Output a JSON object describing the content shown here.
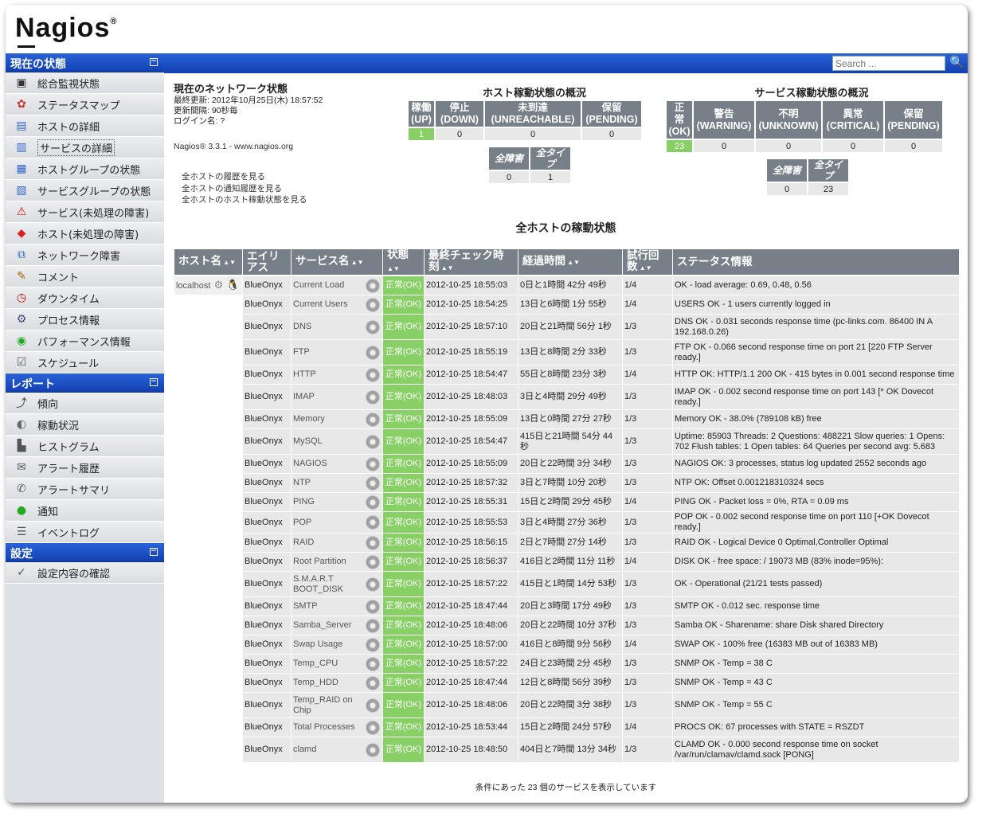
{
  "brand": {
    "logo": "Nagios",
    "mark": "®"
  },
  "sidebar": {
    "sections": [
      {
        "title": "現在の状態",
        "items": [
          {
            "label": "総合監視状態",
            "icon": "monitor-icon"
          },
          {
            "label": "ステータスマップ",
            "icon": "map-icon"
          },
          {
            "label": "ホストの詳細",
            "icon": "host-icon"
          },
          {
            "label": "サービスの詳細",
            "icon": "service-icon",
            "selected": true
          },
          {
            "label": "ホストグループの状態",
            "icon": "hostgroup-icon"
          },
          {
            "label": "サービスグループの状態",
            "icon": "servicegroup-icon"
          },
          {
            "label": "サービス(未処理の障害)",
            "icon": "service-problem-icon"
          },
          {
            "label": "ホスト(未処理の障害)",
            "icon": "host-problem-icon"
          },
          {
            "label": "ネットワーク障害",
            "icon": "network-outage-icon"
          },
          {
            "label": "コメント",
            "icon": "comment-icon"
          },
          {
            "label": "ダウンタイム",
            "icon": "downtime-icon"
          },
          {
            "label": "プロセス情報",
            "icon": "process-icon"
          },
          {
            "label": "パフォーマンス情報",
            "icon": "performance-icon"
          },
          {
            "label": "スケジュール",
            "icon": "schedule-icon"
          }
        ]
      },
      {
        "title": "レポート",
        "items": [
          {
            "label": "傾向",
            "icon": "trend-icon"
          },
          {
            "label": "稼動状況",
            "icon": "availability-icon"
          },
          {
            "label": "ヒストグラム",
            "icon": "histogram-icon"
          },
          {
            "label": "アラート履歴",
            "icon": "alert-history-icon"
          },
          {
            "label": "アラートサマリ",
            "icon": "alert-summary-icon"
          },
          {
            "label": "通知",
            "icon": "notification-icon"
          },
          {
            "label": "イベントログ",
            "icon": "eventlog-icon"
          }
        ]
      },
      {
        "title": "設定",
        "items": [
          {
            "label": "設定内容の確認",
            "icon": "config-icon"
          }
        ]
      }
    ]
  },
  "search": {
    "placeholder": "Search ..."
  },
  "info": {
    "title": "現在のネットワーク状態",
    "last_update": "最終更新: 2012年10月25日(木) 18:57:52",
    "interval": "更新間隔: 90秒毎",
    "login": "ログイン名: ?",
    "version": "Nagios® 3.3.1 - www.nagios.org",
    "links": [
      "全ホストの履歴を見る",
      "全ホストの通知履歴を見る",
      "全ホストのホスト稼動状態を見る"
    ]
  },
  "host_summary": {
    "title": "ホスト稼動状態の概況",
    "headers": [
      [
        "稼働",
        "(UP)"
      ],
      [
        "停止",
        "(DOWN)"
      ],
      [
        "未到達",
        "(UNREACHABLE)"
      ],
      [
        "保留",
        "(PENDING)"
      ]
    ],
    "values": [
      "1",
      "0",
      "0",
      "0"
    ],
    "total_headers": [
      "全障害",
      "全タイプ"
    ],
    "totals": [
      "0",
      "1"
    ]
  },
  "service_summary": {
    "title": "サービス稼動状態の概況",
    "headers": [
      [
        "正",
        "常",
        "(OK)"
      ],
      [
        "警告",
        "(WARNING)"
      ],
      [
        "不明",
        "(UNKNOWN)"
      ],
      [
        "異常",
        "(CRITICAL)"
      ],
      [
        "保留",
        "(PENDING)"
      ]
    ],
    "values": [
      "23",
      "0",
      "0",
      "0",
      "0"
    ],
    "total_headers": [
      "全障害",
      "全タイプ"
    ],
    "totals": [
      "0",
      "23"
    ]
  },
  "table_title": "全ホストの稼動状態",
  "columns": [
    "ホスト名",
    "エイリアス",
    "サービス名",
    "状態",
    "最終チェック時刻",
    "経過時間",
    "試行回数",
    "ステータス情報"
  ],
  "host_name": "localhost",
  "rows": [
    {
      "alias": "BlueOnyx",
      "service": "Current Load",
      "status": "正常(OK)",
      "checked": "2012-10-25 18:55:03",
      "duration": "0日と1時間 42分 49秒",
      "attempt": "1/4",
      "info": "OK - load average: 0.69, 0.48, 0.56"
    },
    {
      "alias": "BlueOnyx",
      "service": "Current Users",
      "status": "正常(OK)",
      "checked": "2012-10-25 18:54:25",
      "duration": "13日と6時間 1分 55秒",
      "attempt": "1/4",
      "info": "USERS OK - 1 users currently logged in"
    },
    {
      "alias": "BlueOnyx",
      "service": "DNS",
      "status": "正常(OK)",
      "checked": "2012-10-25 18:57:10",
      "duration": "20日と21時間 56分 1秒",
      "attempt": "1/3",
      "info": "DNS OK - 0.031 seconds response time (pc-links.com. 86400 IN A 192.168.0.26)"
    },
    {
      "alias": "BlueOnyx",
      "service": "FTP",
      "status": "正常(OK)",
      "checked": "2012-10-25 18:55:19",
      "duration": "13日と8時間 2分 33秒",
      "attempt": "1/3",
      "info": "FTP OK - 0.066 second response time on port 21 [220 FTP Server ready.]"
    },
    {
      "alias": "BlueOnyx",
      "service": "HTTP",
      "status": "正常(OK)",
      "checked": "2012-10-25 18:54:47",
      "duration": "55日と8時間 23分 3秒",
      "attempt": "1/4",
      "info": "HTTP OK: HTTP/1.1 200 OK - 415 bytes in 0.001 second response time"
    },
    {
      "alias": "BlueOnyx",
      "service": "IMAP",
      "status": "正常(OK)",
      "checked": "2012-10-25 18:48:03",
      "duration": "3日と4時間 29分 49秒",
      "attempt": "1/3",
      "info": "IMAP OK - 0.002 second response time on port 143 [* OK Dovecot ready.]"
    },
    {
      "alias": "BlueOnyx",
      "service": "Memory",
      "status": "正常(OK)",
      "checked": "2012-10-25 18:55:09",
      "duration": "13日と0時間 27分 27秒",
      "attempt": "1/3",
      "info": "Memory OK - 38.0% (789108 kB) free"
    },
    {
      "alias": "BlueOnyx",
      "service": "MySQL",
      "status": "正常(OK)",
      "checked": "2012-10-25 18:54:47",
      "duration": "415日と21時間 54分 44秒",
      "attempt": "1/3",
      "info": "Uptime: 85903 Threads: 2 Questions: 488221 Slow queries: 1 Opens: 702 Flush tables: 1 Open tables: 64 Queries per second avg: 5.683"
    },
    {
      "alias": "BlueOnyx",
      "service": "NAGIOS",
      "status": "正常(OK)",
      "checked": "2012-10-25 18:55:09",
      "duration": "20日と22時間 3分 34秒",
      "attempt": "1/3",
      "info": "NAGIOS OK: 3 processes, status log updated 2552 seconds ago"
    },
    {
      "alias": "BlueOnyx",
      "service": "NTP",
      "status": "正常(OK)",
      "checked": "2012-10-25 18:57:32",
      "duration": "3日と7時間 10分 20秒",
      "attempt": "1/3",
      "info": "NTP OK: Offset 0.001218310324 secs"
    },
    {
      "alias": "BlueOnyx",
      "service": "PING",
      "status": "正常(OK)",
      "checked": "2012-10-25 18:55:31",
      "duration": "15日と2時間 29分 45秒",
      "attempt": "1/4",
      "info": "PING OK - Packet loss = 0%, RTA = 0.09 ms"
    },
    {
      "alias": "BlueOnyx",
      "service": "POP",
      "status": "正常(OK)",
      "checked": "2012-10-25 18:55:53",
      "duration": "3日と4時間 27分 36秒",
      "attempt": "1/3",
      "info": "POP OK - 0.002 second response time on port 110 [+OK Dovecot ready.]"
    },
    {
      "alias": "BlueOnyx",
      "service": "RAID",
      "status": "正常(OK)",
      "checked": "2012-10-25 18:56:15",
      "duration": "2日と7時間 27分 14秒",
      "attempt": "1/3",
      "info": "RAID OK - Logical Device 0 Optimal,Controller Optimal"
    },
    {
      "alias": "BlueOnyx",
      "service": "Root Partition",
      "status": "正常(OK)",
      "checked": "2012-10-25 18:56:37",
      "duration": "416日と2時間 11分 11秒",
      "attempt": "1/4",
      "info": "DISK OK - free space: / 19073 MB (83% inode=95%):"
    },
    {
      "alias": "BlueOnyx",
      "service": "S.M.A.R.T BOOT_DISK",
      "status": "正常(OK)",
      "checked": "2012-10-25 18:57:22",
      "duration": "415日と1時間 14分 53秒",
      "attempt": "1/3",
      "info": "OK - Operational (21/21 tests passed)"
    },
    {
      "alias": "BlueOnyx",
      "service": "SMTP",
      "status": "正常(OK)",
      "checked": "2012-10-25 18:47:44",
      "duration": "20日と3時間 17分 49秒",
      "attempt": "1/3",
      "info": "SMTP OK - 0.012 sec. response time"
    },
    {
      "alias": "BlueOnyx",
      "service": "Samba_Server",
      "status": "正常(OK)",
      "checked": "2012-10-25 18:48:06",
      "duration": "20日と22時間 10分 37秒",
      "attempt": "1/3",
      "info": "Samba OK - Sharename: share Disk shared Directory"
    },
    {
      "alias": "BlueOnyx",
      "service": "Swap Usage",
      "status": "正常(OK)",
      "checked": "2012-10-25 18:57:00",
      "duration": "416日と8時間 9分 56秒",
      "attempt": "1/4",
      "info": "SWAP OK - 100% free (16383 MB out of 16383 MB)"
    },
    {
      "alias": "BlueOnyx",
      "service": "Temp_CPU",
      "status": "正常(OK)",
      "checked": "2012-10-25 18:57:22",
      "duration": "24日と23時間 2分 45秒",
      "attempt": "1/3",
      "info": "SNMP OK - Temp = 38 C"
    },
    {
      "alias": "BlueOnyx",
      "service": "Temp_HDD",
      "status": "正常(OK)",
      "checked": "2012-10-25 18:47:44",
      "duration": "12日と8時間 56分 39秒",
      "attempt": "1/3",
      "info": "SNMP OK - Temp = 43 C"
    },
    {
      "alias": "BlueOnyx",
      "service": "Temp_RAID on Chip",
      "status": "正常(OK)",
      "checked": "2012-10-25 18:48:06",
      "duration": "20日と22時間 3分 38秒",
      "attempt": "1/3",
      "info": "SNMP OK - Temp = 55 C"
    },
    {
      "alias": "BlueOnyx",
      "service": "Total Processes",
      "status": "正常(OK)",
      "checked": "2012-10-25 18:53:44",
      "duration": "15日と2時間 24分 57秒",
      "attempt": "1/4",
      "info": "PROCS OK: 67 processes with STATE = RSZDT"
    },
    {
      "alias": "BlueOnyx",
      "service": "clamd",
      "status": "正常(OK)",
      "checked": "2012-10-25 18:48:50",
      "duration": "404日と7時間 13分 34秒",
      "attempt": "1/3",
      "info": "CLAMD OK - 0.000 second response time on socket /var/run/clamav/clamd.sock [PONG]"
    }
  ],
  "tall_rows": [
    2,
    3,
    5,
    7,
    14,
    20,
    22
  ],
  "footer": "条件にあった 23 個のサービスを表示しています",
  "colors": {
    "ok": "#88d066",
    "header": "#777f88",
    "nav_blue": "#1e50c8"
  }
}
